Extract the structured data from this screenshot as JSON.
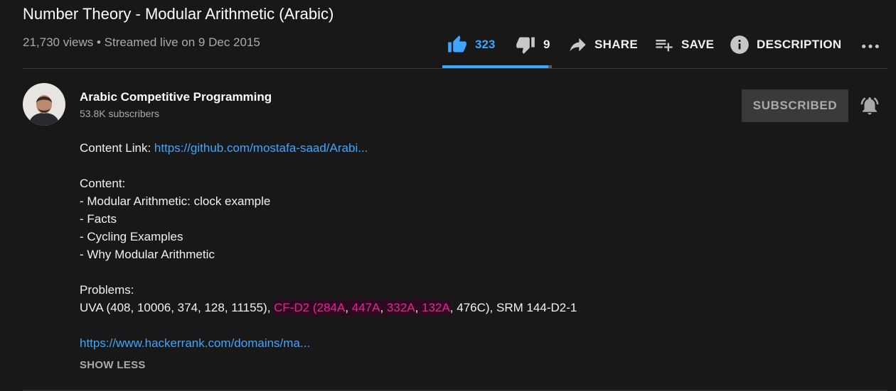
{
  "video": {
    "title": "Number Theory - Modular Arithmetic (Arabic)",
    "meta": "21,730 views • Streamed live on 9 Dec 2015"
  },
  "actions": {
    "likes": "323",
    "dislikes": "9",
    "share_label": "SHARE",
    "save_label": "SAVE",
    "description_label": "DESCRIPTION",
    "like_ratio": 0.97,
    "icons": [
      "thumb-up-icon",
      "thumb-down-icon",
      "share-icon",
      "playlist-add-icon",
      "info-icon",
      "more-icon"
    ]
  },
  "channel": {
    "name": "Arabic Competitive Programming",
    "subscribers": "53.8K subscribers",
    "subscribe_label": "SUBSCRIBED"
  },
  "description": {
    "content_link_label": "Content Link: ",
    "content_link_url": "https://github.com/mostafa-saad/Arabi...",
    "content_heading": "Content:",
    "content_items": [
      "- Modular Arithmetic: clock example",
      "- Facts",
      "- Cycling Examples",
      "- Why Modular Arithmetic"
    ],
    "problems_heading": "Problems:",
    "problems_uva": "UVA (408, 10006, 374, 128, 11155), ",
    "problems_cf_prefix": "CF-D2 (",
    "problems_cf": [
      "284A",
      "447A",
      "332A",
      "132A"
    ],
    "problems_cf_sep": ", ",
    "problems_tail": "476C), SRM 144-D2-1",
    "hackerrank_url": "https://www.hackerrank.com/domains/ma...",
    "show_less_label": "SHOW LESS"
  },
  "colors": {
    "background": "#181818",
    "accent": "#3ea6ff",
    "highlight_text": "#e5249a",
    "highlight_bg": "#2a0a1c",
    "muted": "#aaaaaa"
  }
}
